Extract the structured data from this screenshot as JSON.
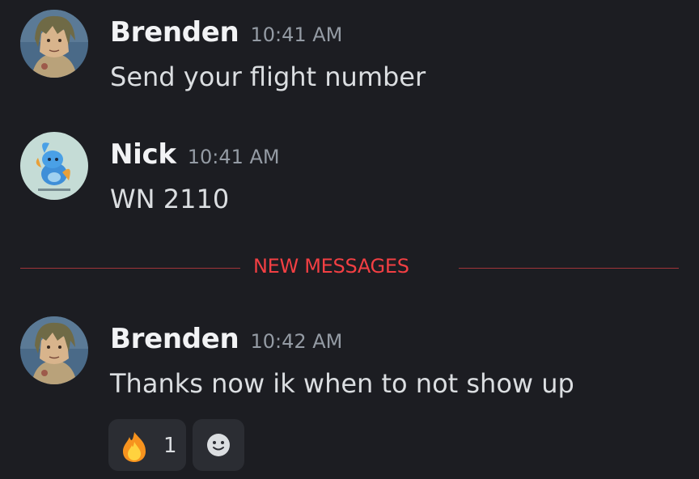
{
  "messages": [
    {
      "username": "Brenden",
      "time": "10:41 AM",
      "text": "Send your flight number"
    },
    {
      "username": "Nick",
      "time": "10:41 AM",
      "text": "WN 2110"
    },
    {
      "username": "Brenden",
      "time": "10:42 AM",
      "text": "Thanks now ik when to not show up"
    }
  ],
  "divider": {
    "label": "NEW MESSAGES",
    "color": "#f23f43"
  },
  "reactions": [
    {
      "emoji": "fire-emoji",
      "count": "1"
    },
    {
      "emoji": "add-reaction-icon"
    }
  ],
  "colors": {
    "background": "#1c1d22",
    "username": "#f2f3f5",
    "timestamp": "#949ba4",
    "text": "#dbdee1",
    "reaction_bg": "#2b2d33"
  }
}
